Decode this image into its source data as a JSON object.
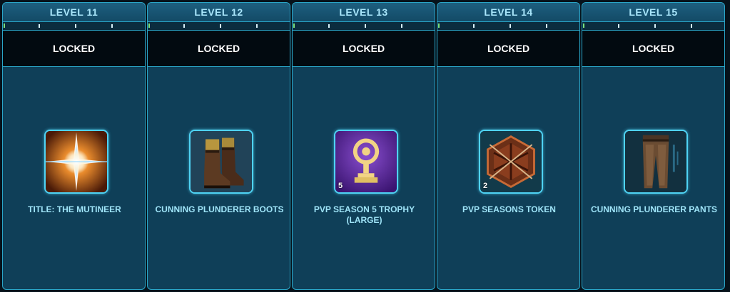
{
  "levels": [
    {
      "level_label": "LEVEL 11",
      "status": "LOCKED",
      "reward_name": "TITLE: THE MUTINEER",
      "icon": "title-burst-icon",
      "stack_count": ""
    },
    {
      "level_label": "LEVEL 12",
      "status": "LOCKED",
      "reward_name": "CUNNING PLUNDERER BOOTS",
      "icon": "boots-icon",
      "stack_count": ""
    },
    {
      "level_label": "LEVEL 13",
      "status": "LOCKED",
      "reward_name": "PVP SEASON 5 TROPHY (LARGE)",
      "icon": "trophy-icon",
      "stack_count": "5"
    },
    {
      "level_label": "LEVEL 14",
      "status": "LOCKED",
      "reward_name": "PVP SEASONS TOKEN",
      "icon": "token-icon",
      "stack_count": "2"
    },
    {
      "level_label": "LEVEL 15",
      "status": "LOCKED",
      "reward_name": "CUNNING PLUNDERER PANTS",
      "icon": "pants-icon",
      "stack_count": ""
    }
  ],
  "colors": {
    "panel_bg": "#0f3f58",
    "border": "#2aa6c8",
    "header_text": "#a9e6fb",
    "reward_text": "#9fe4f8",
    "locked_bar": "#020a10"
  }
}
